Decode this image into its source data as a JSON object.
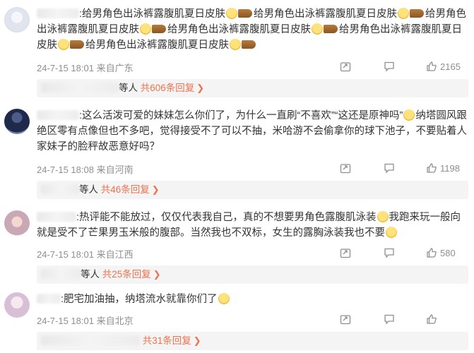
{
  "comments": [
    {
      "text_parts": [
        "给男角色出泳裤露腹肌夏日皮肤",
        "给男角色出泳裤露腹肌夏日皮肤",
        "给男角色出泳裤露腹肌夏日皮肤",
        "给男角色出泳裤露腹肌夏日皮肤",
        "给男角色出泳裤露腹肌夏日皮肤",
        "给男角色出泳裤露腹肌夏日皮肤"
      ],
      "meta": "24-7-15 18:01 来自广东",
      "likes": "2165",
      "reply_prefix": "等人",
      "reply_more": "共606条回复"
    },
    {
      "text_a": "这么活泼可爱的妹妹怎么你们了，为什么一直刷“不喜欢”“这还是原神吗”",
      "text_b": "纳塔圆风跟绝区零有点像但也不多吧，觉得接受不了可以不抽，米哈游不会偷拿你的球下池子，不要贴着人家妹子的脸秤故恶意好吗？",
      "meta": "24-7-15 18:08 来自河南",
      "likes": "1198",
      "reply_prefix": "等人",
      "reply_more": "共46条回复"
    },
    {
      "text_a": "热评能不能放过，仅仅代表我自己，真的不想要男角色露腹肌泳装",
      "text_b": "我跑来玩一般向就是受不了芒果男玉米般的腹部。当然我也不双标，女生的露胸泳装我也不要",
      "meta": "24-7-15 18:01 来自江西",
      "likes": "580",
      "reply_prefix": "等人",
      "reply_more": "共25条回复"
    },
    {
      "text_a": "肥宅加油抽，纳塔流水就靠你们了",
      "meta": "24-7-15 18:01 来自北京",
      "reply_more": "共31条回复"
    }
  ],
  "icons": {
    "share": "share-icon",
    "comment": "comment-icon",
    "like": "like-icon"
  },
  "colors": {
    "accent": "#eb7350",
    "meta": "#8f8f8f",
    "reply_bg": "#f4f4f4"
  }
}
